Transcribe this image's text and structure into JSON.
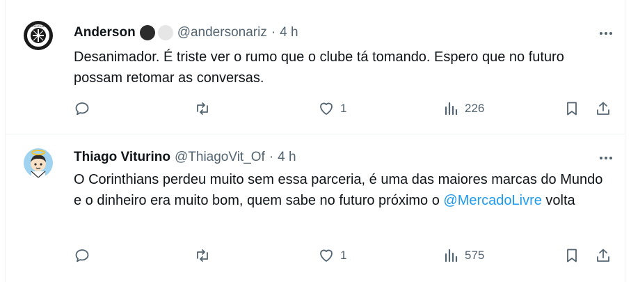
{
  "tweets": [
    {
      "display_name": "Anderson",
      "handle": "@andersonariz",
      "separator": "·",
      "time": "4 h",
      "badges": [
        "#2b2b2b",
        "#e6e6e6"
      ],
      "text": "Desanimador. É triste ver o rumo que o clube tá tomando. Espero que no futuro possam retomar as conversas.",
      "avatar_text": "CORINTHIANS",
      "likes": "1",
      "views": "226"
    },
    {
      "display_name": "Thiago Viturino",
      "handle": "@ThiagoVit_Of",
      "separator": "·",
      "time": "4 h",
      "text_before": "O Corinthians perdeu muito sem essa parceria, é uma das maiores marcas do Mundo e o dinheiro era muito bom, quem sabe no futuro próximo o ",
      "mention": "@MercadoLivre",
      "text_after": " volta",
      "likes": "1",
      "views": "575"
    }
  ],
  "icons": {
    "reply": "reply-icon",
    "retweet": "retweet-icon",
    "like": "heart-icon",
    "views": "views-icon",
    "bookmark": "bookmark-icon",
    "share": "share-icon",
    "more": "more-icon"
  },
  "colors": {
    "text": "#0f1419",
    "secondary": "#536471",
    "link": "#1d9bf0",
    "divider": "#eff3f4"
  }
}
